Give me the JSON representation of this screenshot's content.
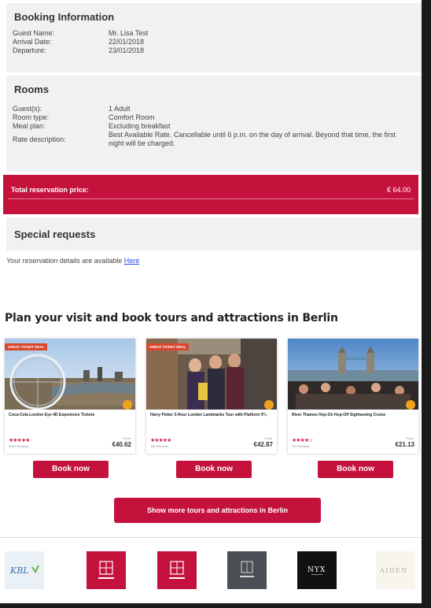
{
  "booking": {
    "title": "Booking Information",
    "rows": [
      {
        "label": "Guest Name:",
        "value": "Mr. Lisa Test"
      },
      {
        "label": "Arrival Date:",
        "value": "22/01/2018"
      },
      {
        "label": "Departure:",
        "value": "23/01/2018"
      }
    ]
  },
  "rooms": {
    "title": "Rooms",
    "rows": [
      {
        "label": "Guest(s):",
        "value": "1 Adult"
      },
      {
        "label": "Room type:",
        "value": "Comfort Room"
      },
      {
        "label": "Meal plan:",
        "value": "Excluding breakfast"
      },
      {
        "label": "Rate description:",
        "value": "Best Available Rate. Cancellable until 6 p.m. on the day of arrival. Beyond that time, the first night will be charged."
      }
    ]
  },
  "total": {
    "label": "Total reservation price:",
    "value": "€ 64.00"
  },
  "special": {
    "title": "Special requests"
  },
  "details": {
    "text": "Your reservation details are available ",
    "link": "Here"
  },
  "plan": {
    "title": "Plan your visit and book tours and attractions in Berlin"
  },
  "tours": [
    {
      "ribbon": "GREAT TICKET DEAL",
      "name": "Coca-Cola London Eye 4D Experience Tickets",
      "stars": "★★★★★",
      "reviews": "2000 Reviews",
      "from": "From",
      "price": "€40.62",
      "book": "Book now"
    },
    {
      "ribbon": "GREAT TICKET DEAL",
      "name": "Harry Potter 3-Hour London Landmarks Tour with Platform 9¾",
      "stars": "★★★★★",
      "reviews": "150 Reviews",
      "from": "From",
      "price": "€42.87",
      "book": "Book now"
    },
    {
      "ribbon": "",
      "name": "River Thames Hop-On Hop-Off Sightseeing Cruise",
      "stars": "★★★★☆",
      "reviews": "370 Reviews",
      "from": "From",
      "price": "€21.13",
      "book": "Book now"
    }
  ],
  "show_more": "Show more tours and attractions in Berlin",
  "partners": [
    {
      "name": "KBL",
      "icon": "kbl-logo"
    },
    {
      "name": "Leonardo Hotels",
      "icon": "leonardo-logo"
    },
    {
      "name": "Leonardo Hotels",
      "icon": "leonardo-logo"
    },
    {
      "name": "Leonardo Royal",
      "icon": "leonardo-royal-logo"
    },
    {
      "name": "NYX",
      "icon": "nyx-logo"
    },
    {
      "name": "AIDEN",
      "icon": "aiden-logo"
    }
  ],
  "colors": {
    "accent": "#c4123d",
    "panel": "#f1f1f3",
    "link": "#2a4bd7"
  }
}
